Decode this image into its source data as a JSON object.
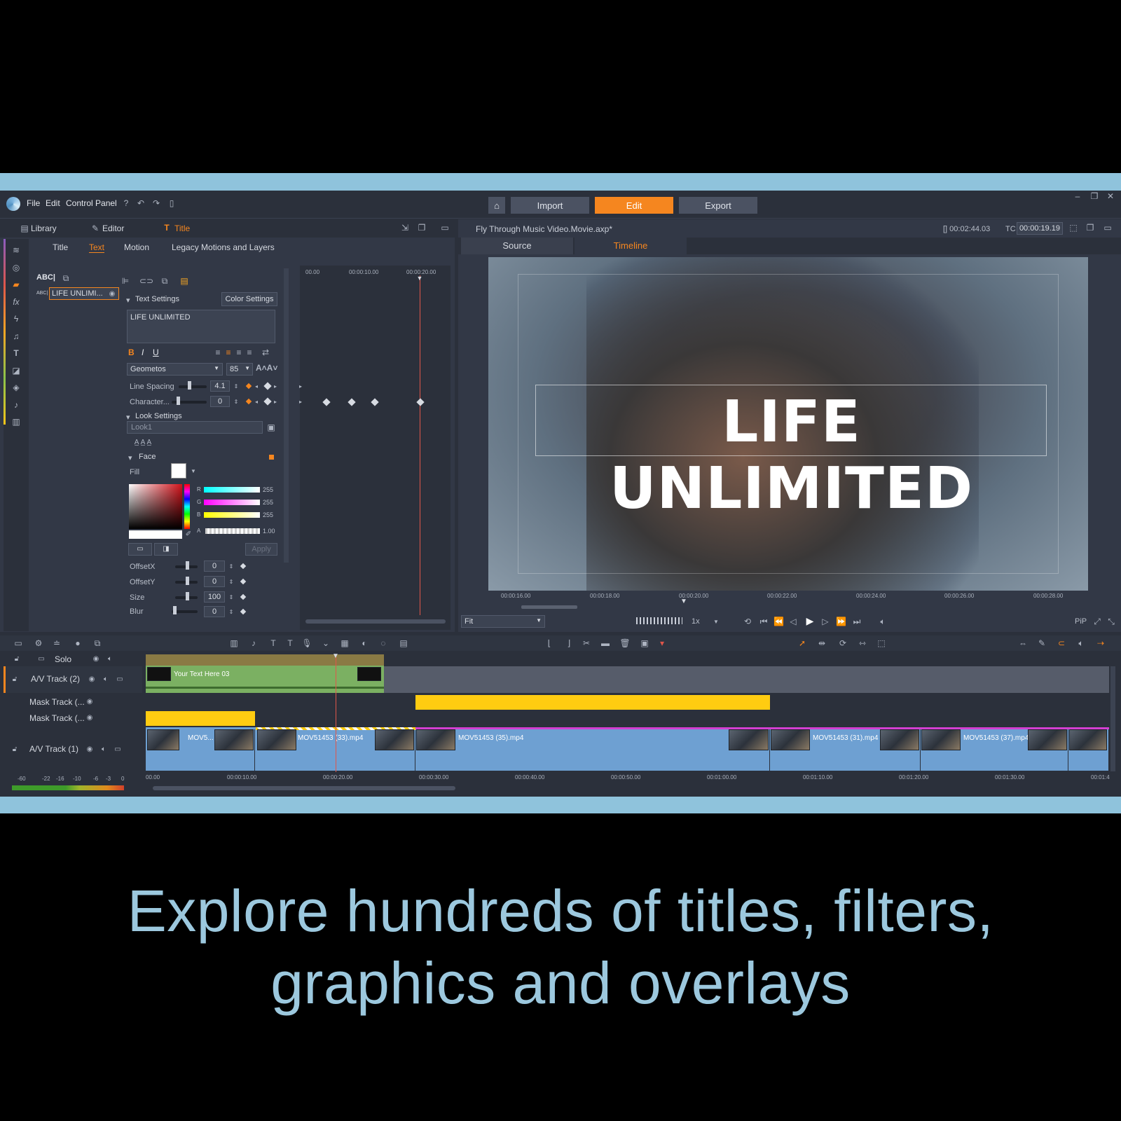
{
  "menu": {
    "items": [
      "File",
      "Edit",
      "Control Panel"
    ]
  },
  "nav": {
    "import": "Import",
    "edit": "Edit",
    "export": "Export"
  },
  "left_panel": {
    "tabs": [
      "Library",
      "Editor",
      "Title"
    ],
    "subtabs": [
      "Title",
      "Text",
      "Motion",
      "Legacy Motions and Layers"
    ],
    "layer_name": "LIFE UNLIMI...",
    "text_settings_label": "Text Settings",
    "color_settings_label": "Color Settings",
    "text_value": "LIFE UNLIMITED",
    "font": "Geometos",
    "font_size": "85",
    "line_spacing_label": "Line Spacing",
    "line_spacing_value": "4.1",
    "character_label": "Character...",
    "character_value": "0",
    "look_settings_label": "Look Settings",
    "look_value": "Look1",
    "face_label": "Face",
    "fill_label": "Fill",
    "rgb": {
      "r": "255",
      "g": "255",
      "b": "255",
      "a": "1.00",
      "r_label": "R",
      "g_label": "G",
      "b_label": "B",
      "a_label": "A"
    },
    "apply_label": "Apply",
    "offsetx_label": "OffsetX",
    "offsetx_value": "0",
    "offsety_label": "OffsetY",
    "offsety_value": "0",
    "size_label": "Size",
    "size_value": "100",
    "blur_label": "Blur",
    "blur_value": "0",
    "abc_label": "ABC|",
    "abc_small": "ABC|",
    "bold": "B",
    "italic": "I",
    "underline": "U",
    "ruler": [
      "00.00",
      "00:00:10.00",
      "00:00:20.00"
    ]
  },
  "preview": {
    "file_title": "Fly Through Music Video.Movie.axp*",
    "duration": "[] 00:02:44.03",
    "tc_label": "TC",
    "timecode": "00:00:19.19",
    "source_tab": "Source",
    "timeline_tab": "Timeline",
    "overlay_text": "LIFE UNLIMITED",
    "ruler": [
      "00:00:16.00",
      "00:00:18.00",
      "00:00:20.00",
      "00:00:22.00",
      "00:00:24.00",
      "00:00:26.00",
      "00:00:28.00"
    ],
    "fit": "Fit",
    "speed": "1x",
    "pip": "PiP"
  },
  "timeline": {
    "solo_label": "Solo",
    "tracks": [
      "A/V Track (2)",
      "Mask Track (...",
      "Mask Track (...",
      "A/V Track (1)"
    ],
    "title_clip": "Your Text Here 03",
    "clips": [
      "MOV5...",
      "MOV51453 (33).mp4",
      "MOV51453 (35).mp4",
      "MOV51453 (31).mp4",
      "MOV51453 (37).mp4"
    ],
    "ruler": [
      "00.00",
      "00:00:10.00",
      "00:00:20.00",
      "00:00:30.00",
      "00:00:40.00",
      "00:00:50.00",
      "00:01:00.00",
      "00:01:10.00",
      "00:01:20.00",
      "00:01:30.00",
      "00:01:4"
    ],
    "meter": [
      "-60",
      "-22",
      "-16",
      "-10",
      "-6",
      "-3",
      "0"
    ]
  },
  "caption": {
    "line1": "Explore hundreds of titles, filters,",
    "line2": "graphics and overlays"
  },
  "colors": {
    "accent": "#f5861f",
    "band": "#8fc3dc",
    "clip": "#6ea0d2",
    "mask": "#ffcc11",
    "caption": "#9cc8de"
  }
}
